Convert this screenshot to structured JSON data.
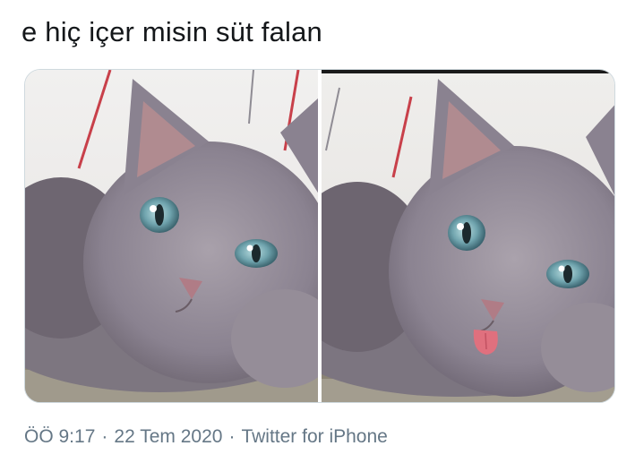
{
  "tweet": {
    "text": "e hiç içer misin süt falan"
  },
  "media": {
    "photos": [
      {
        "icon": "kitten-photo",
        "description_icon": "gray-kitten-resting"
      },
      {
        "icon": "kitten-photo",
        "description_icon": "gray-kitten-tongue-out"
      }
    ]
  },
  "meta": {
    "time": "ÖÖ 9:17",
    "separator": "·",
    "date": "22 Tem 2020",
    "source": "Twitter for iPhone"
  },
  "colors": {
    "text": "#14171a",
    "meta": "#657786",
    "border": "#cfd9de",
    "fur": "#8e8792",
    "eye": "#6fa3ad",
    "tongue": "#e0707e"
  }
}
